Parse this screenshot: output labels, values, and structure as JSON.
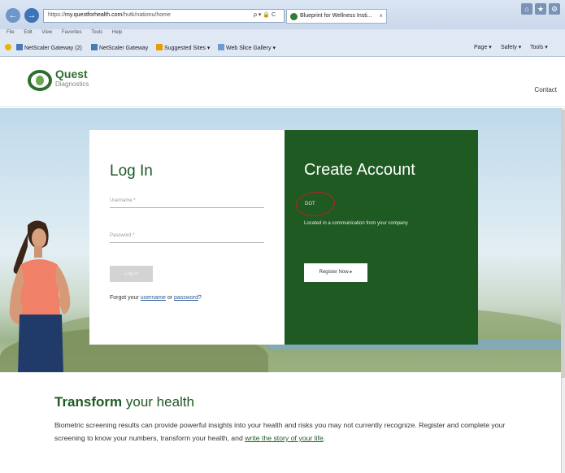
{
  "browser": {
    "url_prefix": "https://",
    "url_host": "my.questforhealth.com",
    "url_path": "/hutk/nationu/home",
    "addr_tools": "ρ ▾ 🔒 C",
    "tab_title": "Blueprint for Wellness Insti...",
    "tab_close": "×",
    "menu": [
      "File",
      "Edit",
      "View",
      "Favorites",
      "Tools",
      "Help"
    ],
    "favorites": [
      "NetScaler Gateway (2)",
      "NetScaler Gateway",
      "Suggested Sites ▾",
      "Web Slice Gallery ▾"
    ],
    "commands": [
      "Page ▾",
      "Safety ▾",
      "Tools ▾"
    ],
    "back_icon": "←",
    "forward_icon": "→"
  },
  "header": {
    "logo_name": "Quest",
    "logo_sub": "Diagnostics",
    "contact": "Contact"
  },
  "login": {
    "title": "Log In",
    "username_placeholder": "Username *",
    "password_placeholder": "Password *",
    "button": "Log In",
    "forgot_prefix": "Forgot your ",
    "forgot_username": "username",
    "forgot_or": " or ",
    "forgot_password": "password",
    "forgot_suffix": "?"
  },
  "create": {
    "title": "Create Account",
    "code_label": "DOT",
    "code_hint": "Located in a communication from your company",
    "register_button": "Register Now ▸"
  },
  "transform": {
    "title_bold": "Transform",
    "title_rest": " your health",
    "body": "Biometric screening results can provide powerful insights into your health and risks you may not currently recognize. Register and complete your screening to know your numbers, transform your health, and ",
    "link": "write the story of your life",
    "body_end": "."
  },
  "colors": {
    "brand_green": "#1f5a23",
    "link_blue": "#2a5a9a",
    "annotation_red": "#c02020"
  }
}
